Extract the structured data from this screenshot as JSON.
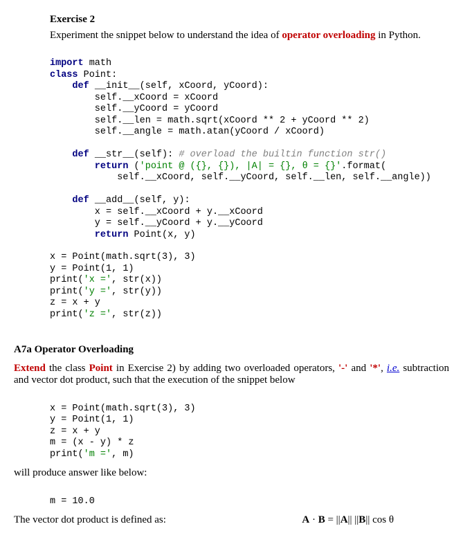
{
  "ex": {
    "title": "Exercise 2",
    "intro_pre": "Experiment the snippet below to understand the idea of ",
    "intro_term": "operator overloading",
    "intro_post": " in Python."
  },
  "code1": {
    "l1a": "import",
    "l1b": " math",
    "l2a": "class",
    "l2b": " Point:",
    "l3a": "    def",
    "l3b": " __init__(self, xCoord, yCoord):",
    "l4": "        self.__xCoord = xCoord",
    "l5": "        self.__yCoord = yCoord",
    "l6": "        self.__len = math.sqrt(xCoord ** 2 + yCoord ** 2)",
    "l7": "        self.__angle = math.atan(yCoord / xCoord)",
    "l8": "",
    "l9a": "    def",
    "l9b": " __str__(self): ",
    "l9c": "# overload the builtin function str()",
    "l10a": "        return",
    "l10b": " (",
    "l10c": "'point @ ({}, {}), |A| = {}, θ = {}'",
    "l10d": ".format(",
    "l11": "            self.__xCoord, self.__yCoord, self.__len, self.__angle))",
    "l12": "",
    "l13a": "    def",
    "l13b": " __add__(self, y):",
    "l14": "        x = self.__xCoord + y.__xCoord",
    "l15": "        y = self.__yCoord + y.__yCoord",
    "l16a": "        return",
    "l16b": " Point(x, y)",
    "l17": "",
    "l18": "x = Point(math.sqrt(3), 3)",
    "l19": "y = Point(1, 1)",
    "l20a": "print(",
    "l20b": "'x ='",
    "l20c": ", str(x))",
    "l21a": "print(",
    "l21b": "'y ='",
    "l21c": ", str(y))",
    "l22": "z = x + y",
    "l23a": "print(",
    "l23b": "'z ='",
    "l23c": ", str(z))"
  },
  "section": {
    "label": "A7a    Operator Overloading"
  },
  "task": {
    "t1": "Extend",
    "t2": " the class ",
    "t3": "Point",
    "t4": " in Exercise 2) by adding two overloaded operators, ",
    "op1": "'-'",
    "t5": " and ",
    "op2": "'*'",
    "t6": ", ",
    "ie": "i.e.",
    "t7": " subtraction and vector dot product, such that the execution of the snippet below"
  },
  "code2": {
    "l1": "x = Point(math.sqrt(3), 3)",
    "l2": "y = Point(1, 1)",
    "l3": "z = x + y",
    "l4": "m = (x - y) * z",
    "l5a": "print(",
    "l5b": "'m ='",
    "l5c": ", m)"
  },
  "after1": "will produce answer like below:",
  "output": "m = 10.0",
  "after2": "The vector dot product is defined as:",
  "formula": {
    "A": "A",
    "dot": " · ",
    "B": "B",
    "eq": " = ||",
    "A2": "A",
    "mid": "|| ||",
    "B2": "B",
    "end": "|| cos θ"
  }
}
